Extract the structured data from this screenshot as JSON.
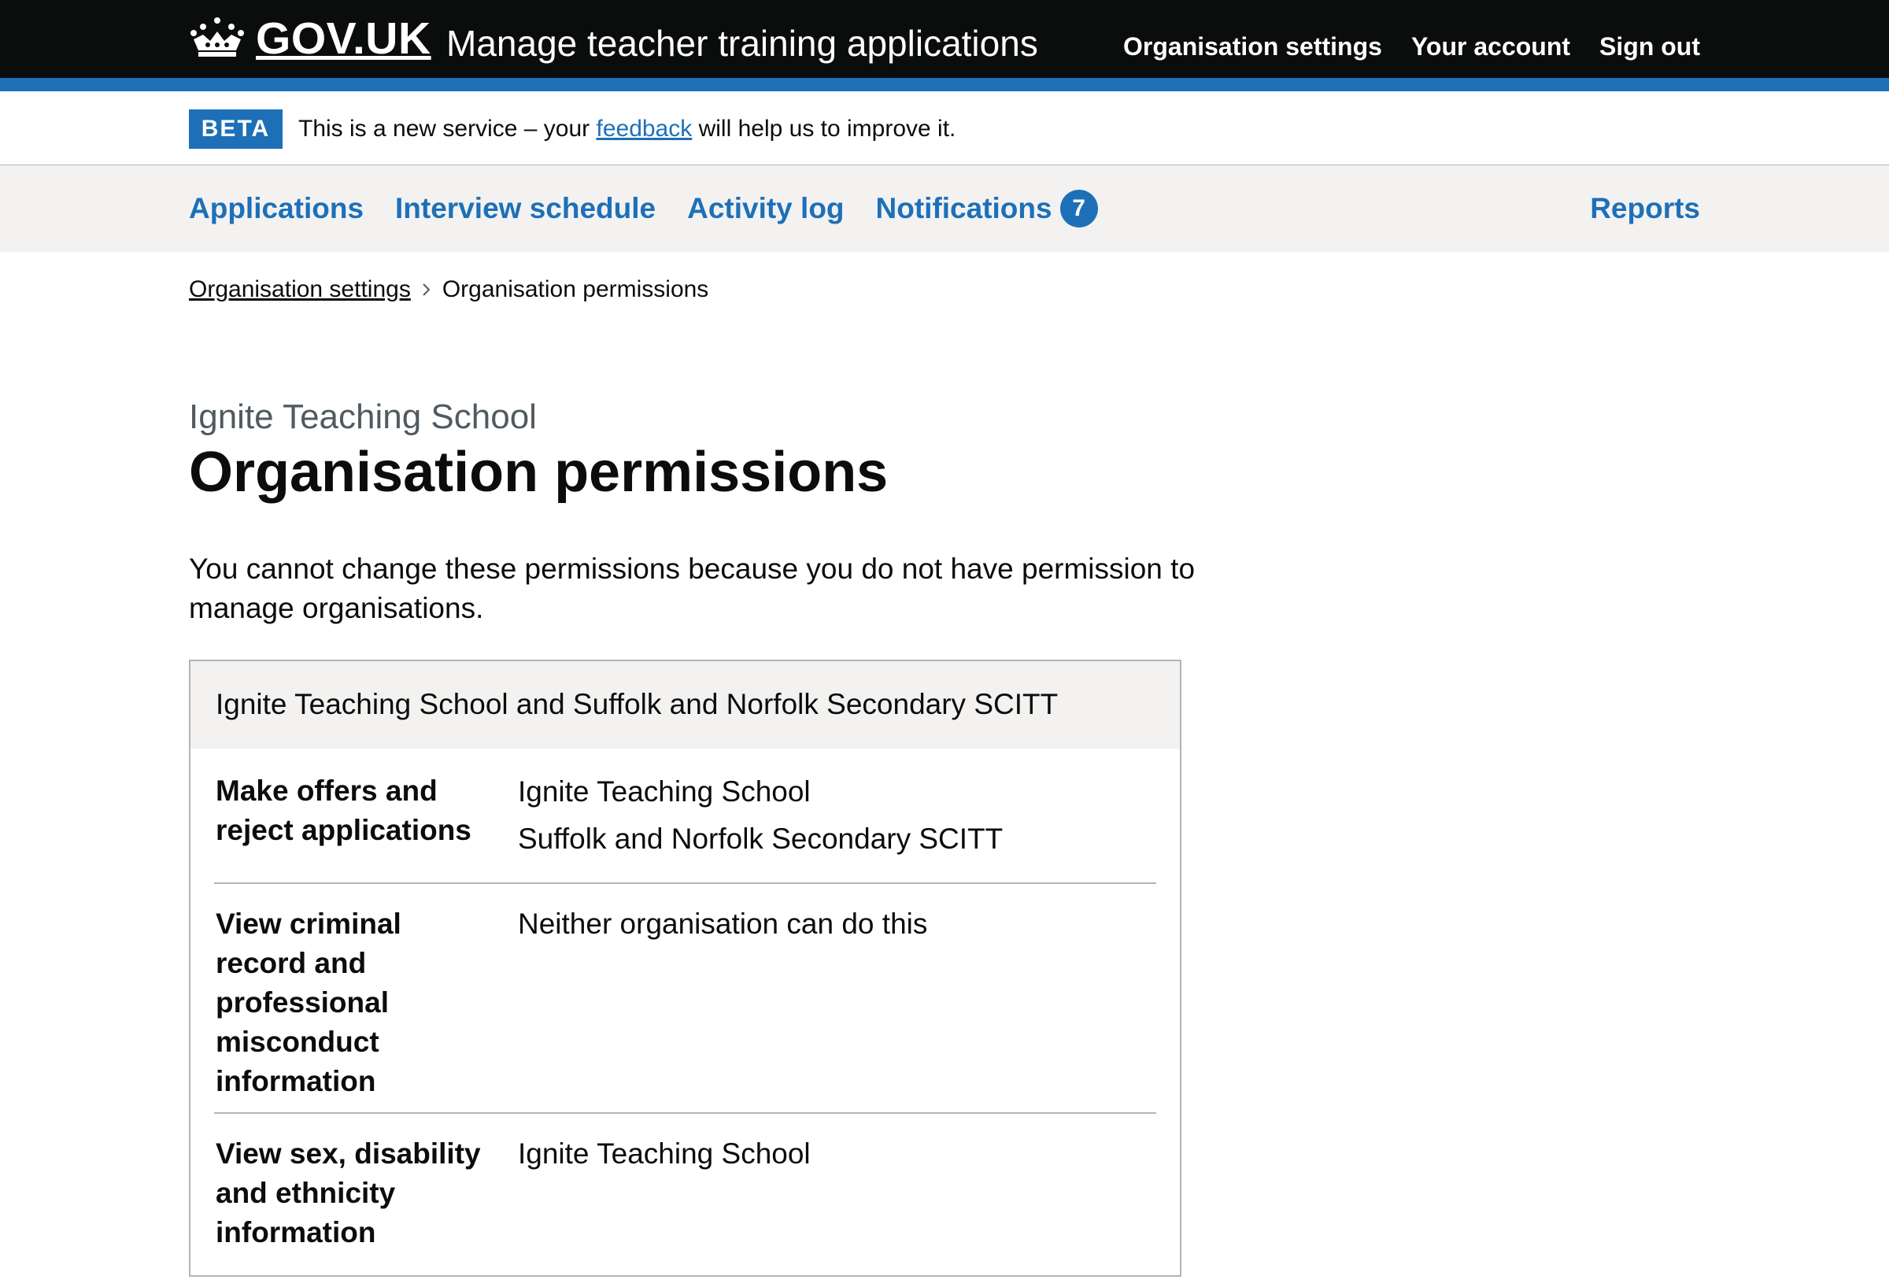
{
  "header": {
    "logo_text": "GOV.UK",
    "service_name": "Manage teacher training applications",
    "nav": [
      "Organisation settings",
      "Your account",
      "Sign out"
    ]
  },
  "beta_banner": {
    "tag": "BETA",
    "text_before": "This is a new service – your ",
    "link_text": "feedback",
    "text_after": " will help us to improve it."
  },
  "primary_nav": {
    "items": [
      "Applications",
      "Interview schedule",
      "Activity log",
      "Notifications"
    ],
    "notifications_count": "7",
    "reports": "Reports"
  },
  "breadcrumb": {
    "parent": "Organisation settings",
    "current": "Organisation permissions"
  },
  "page": {
    "caption": "Ignite Teaching School",
    "title": "Organisation permissions",
    "body": "You cannot change these permissions because you do not have permission to manage organisations."
  },
  "permissions_card": {
    "heading": "Ignite Teaching School and Suffolk and Norfolk Secondary SCITT",
    "rows": [
      {
        "key": "Make offers and reject applications",
        "values": [
          "Ignite Teaching School",
          "Suffolk and Norfolk Secondary SCITT"
        ]
      },
      {
        "key": "View criminal record and professional misconduct information",
        "values": [
          "Neither organisation can do this"
        ]
      },
      {
        "key": "View sex, disability and ethnicity information",
        "values": [
          "Ignite Teaching School"
        ]
      }
    ]
  },
  "colors": {
    "header_bg": "#0b0c0c",
    "brand_blue": "#1d70b8",
    "nav_bg": "#f3f2f1",
    "caption_grey": "#505a5f"
  }
}
